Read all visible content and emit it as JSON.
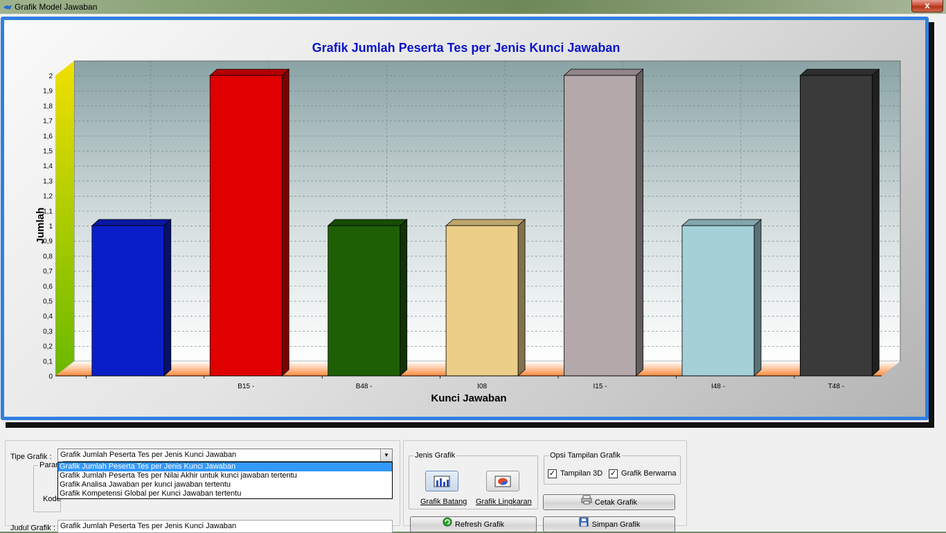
{
  "window": {
    "title": "Grafik Model Jawaban",
    "close_label": "x"
  },
  "chart_data": {
    "type": "bar",
    "title": "Grafik Jumlah Peserta Tes per Jenis Kunci Jawaban",
    "xlabel": "Kunci Jawaban",
    "ylabel": "Jumlah",
    "ylim": [
      0,
      2
    ],
    "y_ticks": [
      "0",
      "0,1",
      "0,2",
      "0,3",
      "0,4",
      "0,5",
      "0,6",
      "0,7",
      "0,8",
      "0,9",
      "1",
      "1,1",
      "1,2",
      "1,3",
      "1,4",
      "1,5",
      "1,6",
      "1,7",
      "1,8",
      "1,9",
      "2"
    ],
    "categories": [
      "",
      "B15 -",
      "B48 -",
      "I08",
      "I15 -",
      "I48 -",
      "T48 -"
    ],
    "x_tick_labels": [
      "B15 -",
      "B48 -",
      "I08",
      "I15 -",
      "I48 -",
      "T48 -"
    ],
    "values": [
      1,
      2,
      1,
      1,
      2,
      1,
      2
    ],
    "colors": [
      "#0a1ec8",
      "#e00000",
      "#1e5f06",
      "#ecce88",
      "#b4a8ab",
      "#a4d0d8",
      "#3a3a3a"
    ],
    "view_3d": true,
    "grid": true,
    "legend": "none"
  },
  "controls": {
    "tipe_label": "Tipe Grafik :",
    "tipe_value": "Grafik Jumlah Peserta Tes per Jenis Kunci Jawaban",
    "tipe_options": [
      "Grafik Jumlah Peserta Tes per Jenis Kunci Jawaban",
      "Grafik Jumlah Peserta Tes per Nilai Akhir untuk kunci jawaban tertentu",
      "Grafik Analisa Jawaban per kunci jawaban tertentu",
      "Grafik Kompetensi Global per Kunci Jawaban tertentu"
    ],
    "param_partial": "Param",
    "kode_partial": "Kode",
    "judul_label": "Judul Grafik :",
    "judul_value": "Grafik Jumlah Peserta Tes per Jenis Kunci Jawaban",
    "jenis_title": "Jenis Grafik",
    "batang_label": "Grafik Batang",
    "lingkaran_label": "Grafik Lingkaran",
    "refresh_label": "Refresh Grafik",
    "opsi_title": "Opsi Tampilan Grafik",
    "tampilan3d_label": "Tampilan 3D",
    "tampilan3d_checked": true,
    "berwarna_label": "Grafik Berwarna",
    "berwarna_checked": true,
    "cetak_label": "Cetak Grafik",
    "simpan_label": "Simpan Grafik"
  }
}
